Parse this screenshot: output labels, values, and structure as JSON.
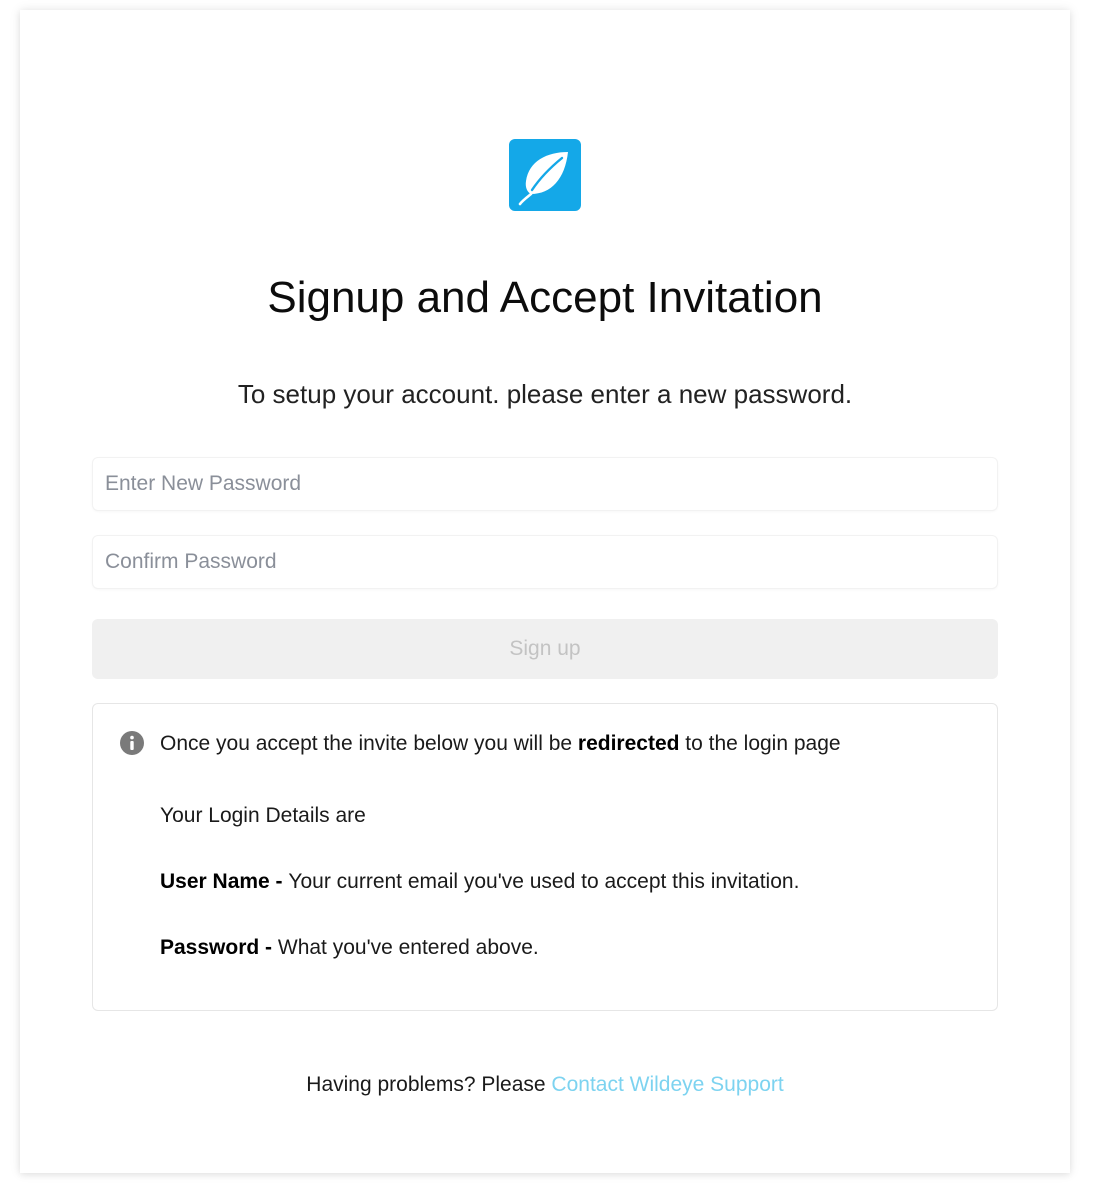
{
  "brand": {
    "logo_icon": "leaf-icon",
    "logo_color": "#14a8e8"
  },
  "page": {
    "title": "Signup and Accept Invitation",
    "subtitle": "To setup your account. please enter a new password."
  },
  "form": {
    "new_password_placeholder": "Enter New Password",
    "new_password_value": "",
    "confirm_password_placeholder": "Confirm Password",
    "confirm_password_value": "",
    "signup_label": "Sign up",
    "signup_disabled": true
  },
  "info": {
    "icon": "info-circle-icon",
    "line1_before": "Once you accept the invite below you will be ",
    "line1_bold": "redirected",
    "line1_after": " to the login page",
    "line2": "Your Login Details are",
    "username_label": "User Name - ",
    "username_text": "Your current email you've used to accept this invitation.",
    "password_label": "Password - ",
    "password_text": "What you've entered above."
  },
  "footer": {
    "prompt": "Having problems? Please ",
    "link_text": "Contact Wildeye Support",
    "link_color": "#7dd3f0"
  }
}
